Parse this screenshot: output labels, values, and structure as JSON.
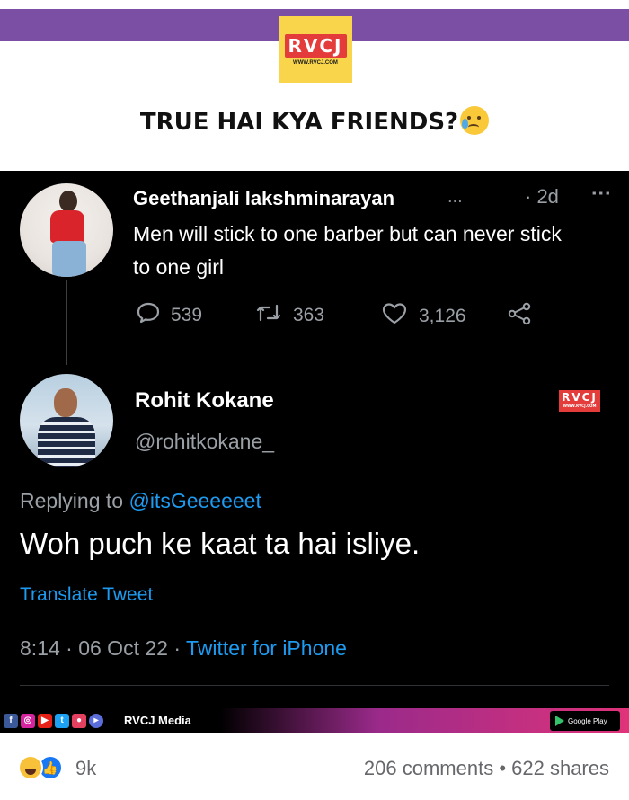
{
  "header": {
    "logo_text": "RVCJ",
    "logo_url": "WWW.RVCJ.COM",
    "headline": "TRUE HAI KYA FRIENDS?",
    "headline_emoji": "crying-face-emoji"
  },
  "tweet1": {
    "name": "Geethanjali lakshminarayan",
    "truncation": "...",
    "time": "· 2d",
    "menu": "⋮",
    "text": "Men will stick to one barber but can never stick to one girl",
    "replies": "539",
    "retweets": "363",
    "likes": "3,126"
  },
  "tweet2": {
    "name": "Rohit Kokane",
    "handle": "@rohitkokane_",
    "badge": "RVCJ",
    "replying_prefix": "Replying to ",
    "replying_mention": "@itsGeeeeeet",
    "text": "Woh puch ke kaat ta hai isliye.",
    "translate": "Translate Tweet",
    "timestamp": "8:14 · 06 Oct 22 · ",
    "client": "Twitter for iPhone"
  },
  "footer": {
    "media_label": "RVCJ Media",
    "store_label": "Google Play"
  },
  "post_stats": {
    "reaction_count": "9k",
    "comments_shares": "206 comments • 622 shares"
  },
  "colors": {
    "brand_purple": "#7b4fa4",
    "logo_yellow": "#f8d54a",
    "twitter_blue": "#1d9bf0",
    "facebook_blue": "#1877f2"
  }
}
